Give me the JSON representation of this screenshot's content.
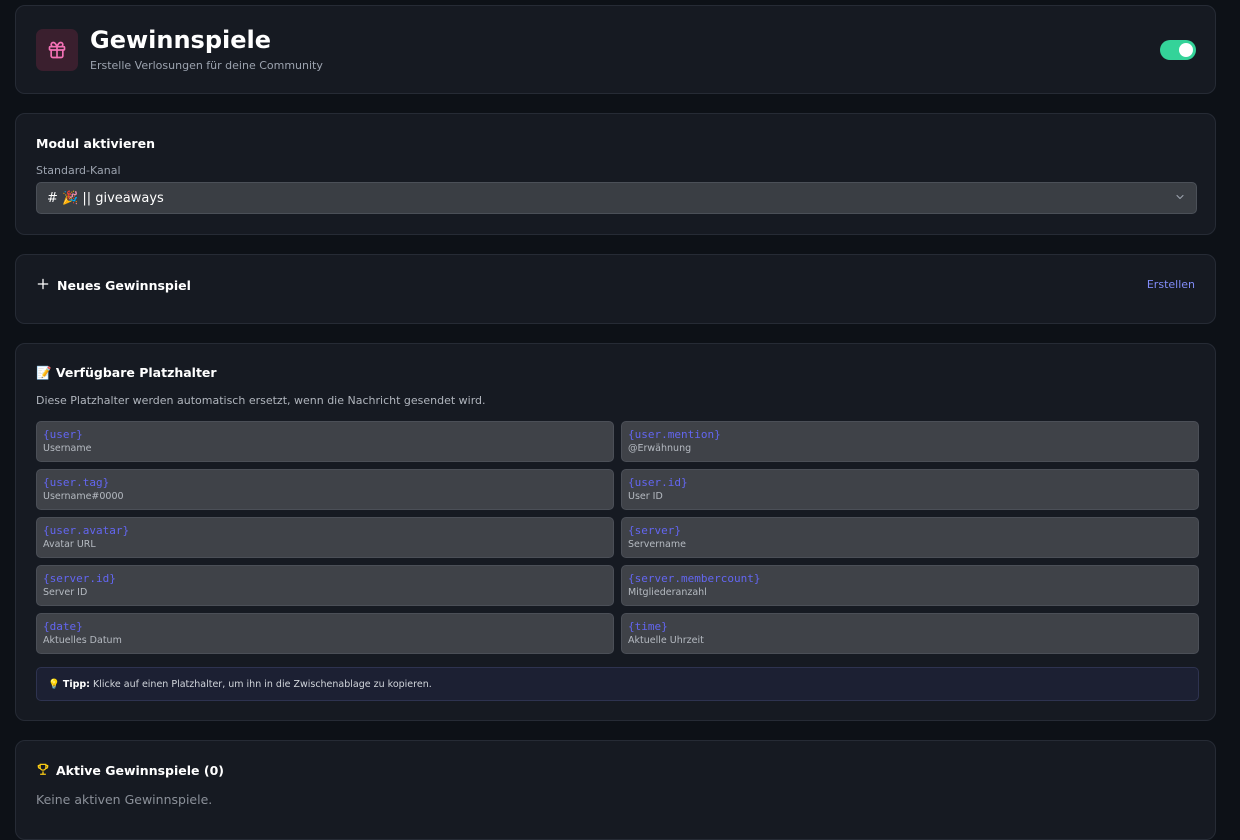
{
  "header": {
    "title": "Gewinnspiele",
    "subtitle": "Erstelle Verlosungen für deine Community",
    "icon": "gift-icon",
    "enabled": true,
    "accent": "#34d399"
  },
  "module": {
    "title": "Modul aktivieren",
    "channel_label": "Standard-Kanal",
    "channel_value": "# 🎉 |‌| giveaways"
  },
  "new_giveaway": {
    "label": "Neues Gewinnspiel",
    "action": "Erstellen"
  },
  "placeholders": {
    "title": "📝 Verfügbare Platzhalter",
    "description": "Diese Platzhalter werden automatisch ersetzt, wenn die Nachricht gesendet wird.",
    "items": [
      {
        "code": "{user}",
        "label": "Username"
      },
      {
        "code": "{user.mention}",
        "label": "@Erwähnung"
      },
      {
        "code": "{user.tag}",
        "label": "Username#0000"
      },
      {
        "code": "{user.id}",
        "label": "User ID"
      },
      {
        "code": "{user.avatar}",
        "label": "Avatar URL"
      },
      {
        "code": "{server}",
        "label": "Servername"
      },
      {
        "code": "{server.id}",
        "label": "Server ID"
      },
      {
        "code": "{server.membercount}",
        "label": "Mitgliederanzahl"
      },
      {
        "code": "{date}",
        "label": "Aktuelles Datum"
      },
      {
        "code": "{time}",
        "label": "Aktuelle Uhrzeit"
      }
    ],
    "tip_icon": "💡",
    "tip_label": "Tipp:",
    "tip_text": "Klicke auf einen Platzhalter, um ihn in die Zwischenablage zu kopieren."
  },
  "active": {
    "title": "Aktive Gewinnspiele (0)",
    "empty": "Keine aktiven Gewinnspiele."
  }
}
